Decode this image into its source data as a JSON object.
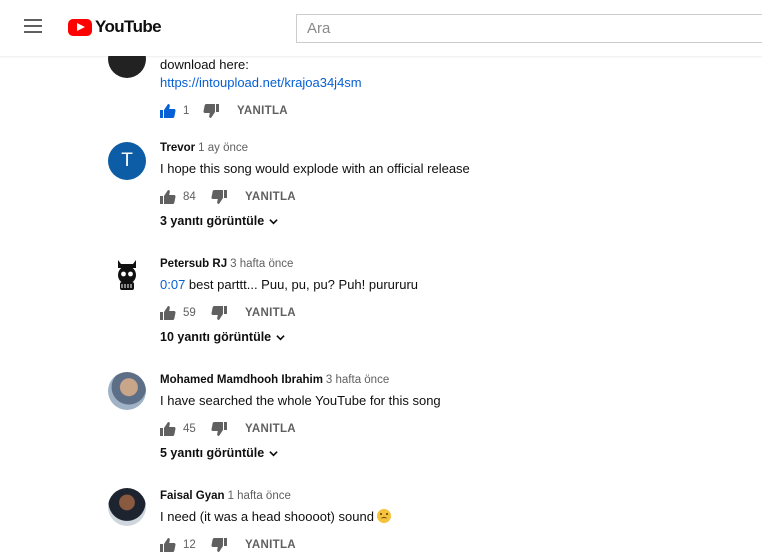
{
  "app": {
    "brand": "YouTube",
    "search_placeholder": "Ara"
  },
  "icons": {
    "menu": "hamburger-icon",
    "logo": "youtube-logo-icon",
    "like": "thumbs-up-icon",
    "dislike": "thumbs-down-icon",
    "expand": "chevron-down-icon"
  },
  "colors": {
    "brand_red": "#ff0000",
    "link_blue": "#065fd4",
    "avatar_blue": "#0c5da5"
  },
  "comments": [
    {
      "author": "",
      "time": "",
      "text": "download here:",
      "link": "https://intoupload.net/krajoa34j4sm",
      "likes": "1",
      "liked": true,
      "reply_label": "YANITLA",
      "replies": ""
    },
    {
      "author": "Trevor",
      "time": "1 ay önce",
      "avatar_letter": "T",
      "text": "I hope this song would explode with an official release",
      "likes": "84",
      "reply_label": "YANITLA",
      "replies": "3 yanıtı görüntüle"
    },
    {
      "author": "Petersub RJ",
      "time": "3 hafta önce",
      "timestamp_link": "0:07",
      "text": " best parttt... Puu, pu, pu? Puh! purururu",
      "likes": "59",
      "reply_label": "YANITLA",
      "replies": "10 yanıtı görüntüle"
    },
    {
      "author": "Mohamed Mamdhooh Ibrahim",
      "time": "3 hafta önce",
      "text": "I have searched the whole YouTube for this song",
      "likes": "45",
      "reply_label": "YANITLA",
      "replies": "5 yanıtı görüntüle"
    },
    {
      "author": "Faisal Gyan",
      "time": "1 hafta önce",
      "text": "I need (it was a head shoooot) sound",
      "emoji": "sad-face-emoji",
      "likes": "12",
      "reply_label": "YANITLA",
      "replies": ""
    }
  ]
}
